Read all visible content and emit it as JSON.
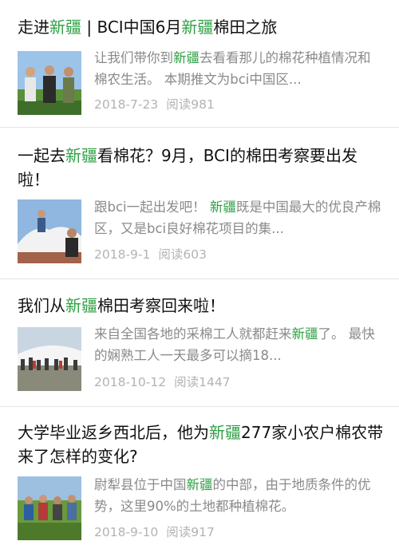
{
  "articles": [
    {
      "title": {
        "a": "走进",
        "hl": "新疆",
        "b": " | BCI中国6月",
        "hl2": "新疆",
        "c": "棉田之旅"
      },
      "excerpt": {
        "a": "让我们带你到",
        "hl": "新疆",
        "b": "去看看那儿的棉花种植情况和棉农生活。 本期推文为bci中国区..."
      },
      "date": "2018-7-23",
      "reads": "阅读981"
    },
    {
      "title": {
        "a": "一起去",
        "hl": "新疆",
        "b": "看棉花？9月，BCI的棉田考察要出发啦！"
      },
      "excerpt": {
        "a": "跟bci一起出发吧！ ",
        "hl": "新疆",
        "b": "既是中国最大的优良产棉区，又是bci良好棉花项目的集..."
      },
      "date": "2018-9-1",
      "reads": "阅读603"
    },
    {
      "title": {
        "a": "我们从",
        "hl": "新疆",
        "b": "棉田考察回来啦！"
      },
      "excerpt": {
        "a": "来自全国各地的采棉工人就都赶来",
        "hl": "新疆",
        "b": "了。 最快的娴熟工人一天最多可以摘18..."
      },
      "date": "2018-10-12",
      "reads": "阅读1447"
    },
    {
      "title": {
        "a": "大学毕业返乡西北后，他为",
        "hl": "新疆",
        "b": "277家小农户棉农带来了怎样的变化?"
      },
      "excerpt": {
        "a": "尉犁县位于中国",
        "hl": "新疆",
        "b": "的中部，由于地质条件的优势，这里90%的土地都种植棉花。"
      },
      "date": "2018-9-10",
      "reads": "阅读917"
    }
  ],
  "colors": {
    "highlight": "#2ea043",
    "meta": "#b3b3b3",
    "excerpt": "#8a8a8a"
  }
}
